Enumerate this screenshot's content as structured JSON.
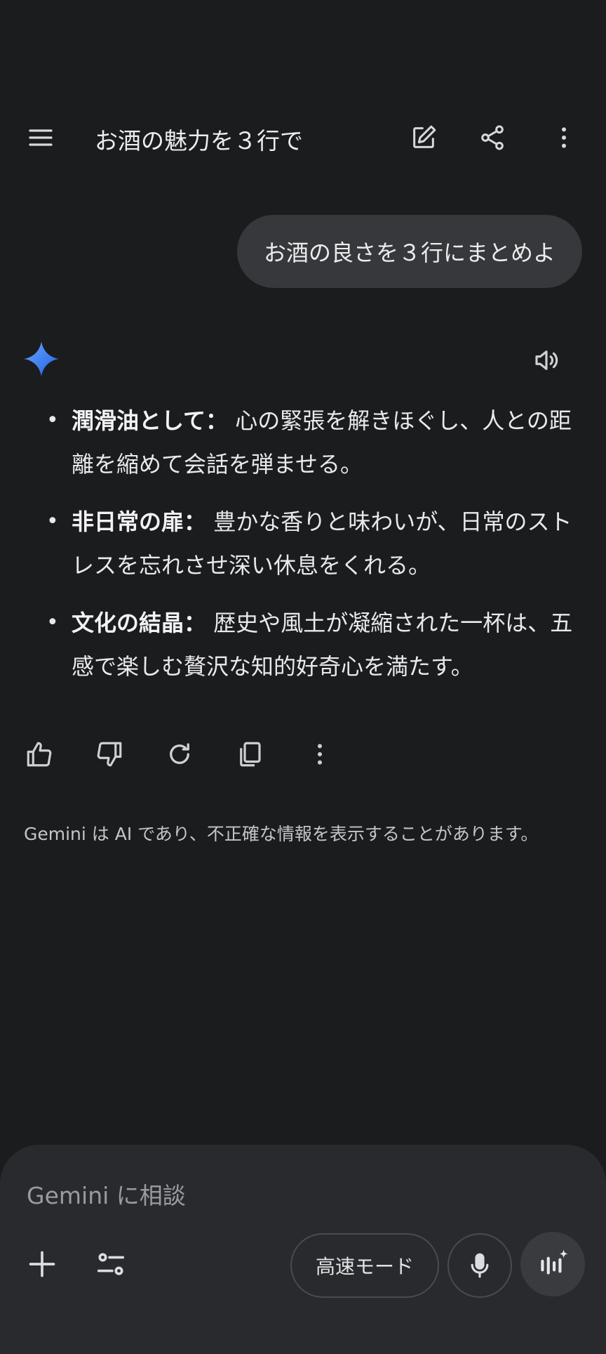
{
  "header": {
    "title": "お酒の魅力を３行で"
  },
  "conversation": {
    "user_message": "お酒の良さを３行にまとめよ",
    "response": {
      "items": [
        {
          "heading": "潤滑油として：",
          "text": " 心の緊張を解きほぐし、人との距離を縮めて会話を弾ませる。"
        },
        {
          "heading": "非日常の扉：",
          "text": " 豊かな香りと味わいが、日常のストレスを忘れさせ深い休息をくれる。"
        },
        {
          "heading": "文化の結晶：",
          "text": " 歴史や風土が凝縮された一杯は、五感で楽しむ贅沢な知的好奇心を満たす。"
        }
      ]
    },
    "bullet_symbol": "•"
  },
  "disclaimer": "Gemini は AI であり、不正確な情報を表示することがあります。",
  "composer": {
    "placeholder": "Gemini に相談",
    "mode_label": "高速モード"
  },
  "icons": {
    "menu": "menu-icon",
    "edit": "edit-icon",
    "share": "share-icon",
    "more": "more-vert-icon",
    "sparkle": "gemini-sparkle-icon",
    "speaker": "speaker-icon",
    "thumbs_up": "thumbs-up-icon",
    "thumbs_down": "thumbs-down-icon",
    "regenerate": "refresh-icon",
    "copy": "copy-icon",
    "plus": "plus-icon",
    "tools": "tools-icon",
    "mic": "mic-icon",
    "live": "live-icon"
  },
  "colors": {
    "background": "#1b1c1e",
    "bubble": "#37383b",
    "composer": "#292a2d",
    "sparkle_start": "#4f8ff7",
    "sparkle_end": "#1f6ae8"
  }
}
